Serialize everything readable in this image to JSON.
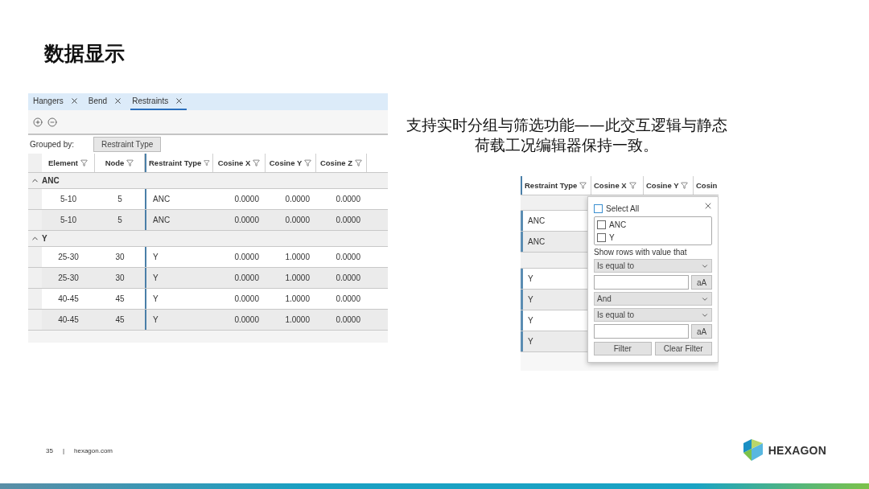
{
  "slide_title": "数据显示",
  "grid_panel": {
    "tabs": [
      {
        "label": "Hangers",
        "selected": false
      },
      {
        "label": "Bend",
        "selected": false
      },
      {
        "label": "Restraints",
        "selected": true
      }
    ],
    "grouped_by": {
      "label": "Grouped by:",
      "chip": "Restraint Type"
    },
    "columns": [
      "Element",
      "Node",
      "Restraint Type",
      "Cosine X",
      "Cosine Y",
      "Cosine Z"
    ],
    "groups": [
      {
        "label": "ANC",
        "expanded": true,
        "rows": [
          [
            "5-10",
            "5",
            "ANC",
            "0.0000",
            "0.0000",
            "0.0000"
          ],
          [
            "5-10",
            "5",
            "ANC",
            "0.0000",
            "0.0000",
            "0.0000"
          ]
        ]
      },
      {
        "label": "Y",
        "expanded": true,
        "rows": [
          [
            "25-30",
            "30",
            "Y",
            "0.0000",
            "1.0000",
            "0.0000"
          ],
          [
            "25-30",
            "30",
            "Y",
            "0.0000",
            "1.0000",
            "0.0000"
          ],
          [
            "40-45",
            "45",
            "Y",
            "0.0000",
            "1.0000",
            "0.0000"
          ],
          [
            "40-45",
            "45",
            "Y",
            "0.0000",
            "1.0000",
            "0.0000"
          ]
        ]
      }
    ]
  },
  "caption": "支持实时分组与筛选功能——此交互逻辑与静态荷载工况编辑器保持一致。",
  "filter_panel": {
    "columns": [
      "Restraint Type",
      "Cosine X",
      "Cosine Y",
      "Cosin"
    ],
    "groups": [
      {
        "rows": [
          "ANC",
          "ANC"
        ]
      },
      {
        "rows": [
          "Y",
          "Y",
          "Y",
          "Y"
        ]
      }
    ],
    "popup": {
      "select_all": {
        "label": "Select All",
        "checked": false
      },
      "options": [
        {
          "label": "ANC",
          "checked": false
        },
        {
          "label": "Y",
          "checked": false
        }
      ],
      "prompt": "Show rows with value that",
      "condition_1": "Is equal to",
      "case_button_1": "aA",
      "operator": "And",
      "condition_2": "Is equal to",
      "case_button_2": "aA",
      "buttons": [
        "Filter",
        "Clear Filter"
      ]
    }
  },
  "footer": {
    "page_number": "35",
    "separator": "|",
    "site": "hexagon.com",
    "logo_text": "HEXAGON"
  }
}
